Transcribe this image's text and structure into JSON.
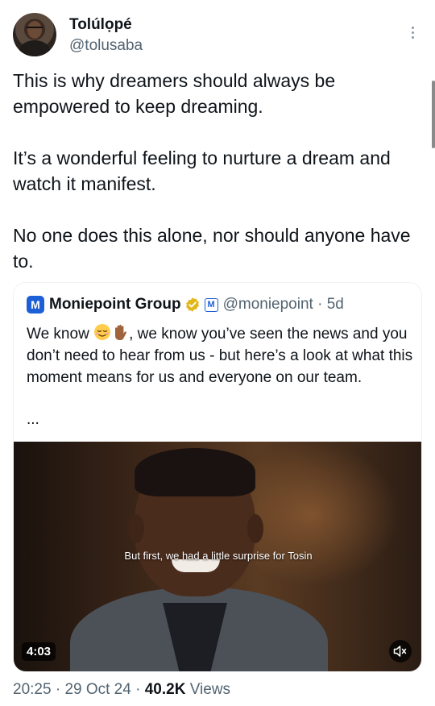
{
  "author": {
    "display_name": "Tolúlọpé",
    "handle": "@tolusaba",
    "more_icon": "more-vertical-icon"
  },
  "tweet": {
    "paragraphs": [
      "This is why dreamers should always be empowered to keep dreaming.",
      "It’s a wonderful feeling to nurture a dream and watch it manifest.",
      "No one does this alone, nor should anyone have to."
    ]
  },
  "quoted": {
    "logo_letter": "M",
    "name": "Moniepoint Group",
    "verified_icon": "gold-verified-badge-icon",
    "affiliate_letter": "M",
    "handle": "@moniepoint",
    "separator": "·",
    "time": "5d",
    "text_before_emoji": "We know ",
    "emojis": [
      "relieved-face-emoji",
      "raised-hand-emoji"
    ],
    "text_after_emoji": ", we know you’ve seen the news and you don’t need to hear from us - but here’s a look at what this moment means for us and everyone on our team.",
    "ellipsis": "...",
    "video": {
      "caption": "But first, we had a little surprise for Tosin",
      "duration": "4:03",
      "mute_icon": "speaker-muted-icon"
    }
  },
  "meta": {
    "time": "20:25",
    "sep1": " · ",
    "date": "29 Oct 24",
    "sep2": " · ",
    "views_count": "40.2K",
    "views_label": " Views"
  },
  "colors": {
    "text": "#0f1419",
    "secondary": "#536471",
    "brand_blue": "#1d5fd6",
    "verified_gold": "#e2b719"
  }
}
